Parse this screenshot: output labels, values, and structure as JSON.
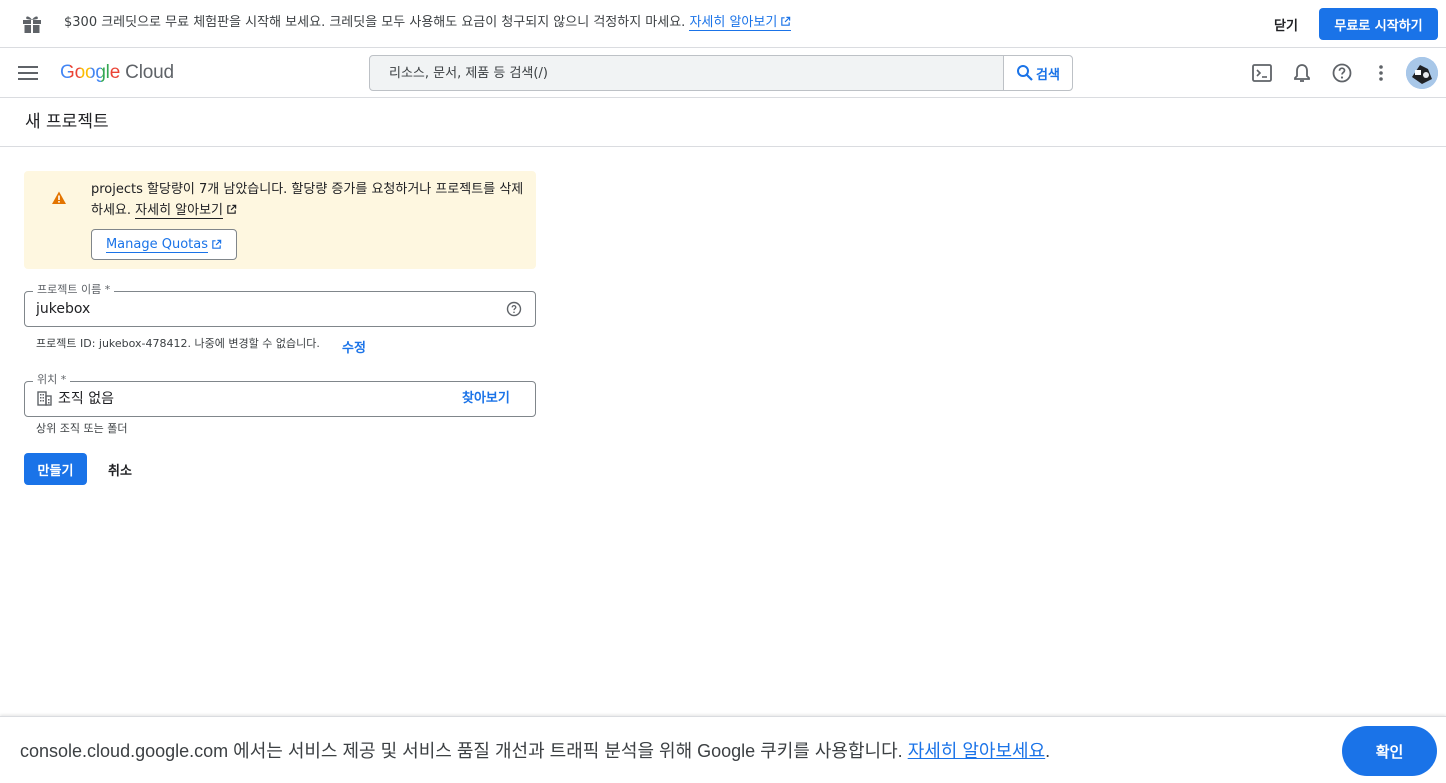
{
  "promo": {
    "text": "$300 크레딧으로 무료 체험판을 시작해 보세요. 크레딧을 모두 사용해도 요금이 청구되지 않으니 걱정하지 마세요.",
    "link": "자세히 알아보기",
    "close_label": "닫기",
    "trial_label": "무료로 시작하기"
  },
  "header": {
    "logo_google": "Google",
    "logo_cloud": "Cloud",
    "search_placeholder": "리소스, 문서, 제품 등 검색(/)",
    "search_button": "검색"
  },
  "page": {
    "title": "새 프로젝트"
  },
  "warning": {
    "text": "projects 할당량이 7개 남았습니다. 할당량 증가를 요청하거나 프로젝트를 삭제하세요.",
    "link": "자세히 알아보기",
    "button": "Manage Quotas"
  },
  "form": {
    "project_name_label": "프로젝트 이름 *",
    "project_name_value": "jukebox",
    "project_id_hint": "프로젝트 ID: jukebox-478412. 나중에 변경할 수 없습니다.",
    "edit_label": "수정",
    "location_label": "위치 *",
    "location_value": "조직 없음",
    "browse_label": "찾아보기",
    "location_hint": "상위 조직 또는 폴더",
    "create_label": "만들기",
    "cancel_label": "취소"
  },
  "cookie": {
    "text": "console.cloud.google.com 에서는 서비스 제공 및 서비스 품질 개선과 트래픽 분석을 위해 Google 쿠키를 사용합니다.",
    "link": "자세히 알아보세요",
    "period": ".",
    "ok_label": "확인"
  },
  "colors": {
    "accent": "#1a73e8",
    "warning_bg": "#fef7e0",
    "warning_icon": "#e37400"
  }
}
